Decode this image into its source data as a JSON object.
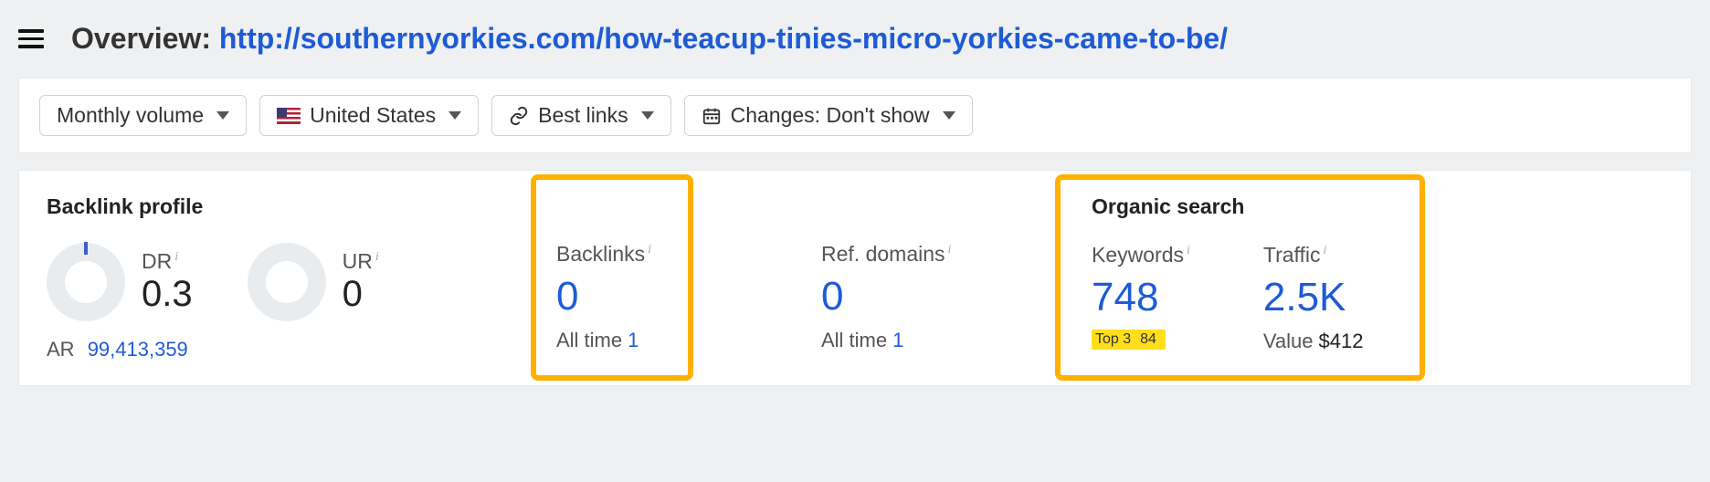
{
  "header": {
    "title_prefix": "Overview: ",
    "url": "http://southernyorkies.com/how-teacup-tinies-micro-yorkies-came-to-be/"
  },
  "toolbar": {
    "volume": "Monthly volume",
    "country": "United States",
    "best_links": "Best links",
    "changes": "Changes: Don't show"
  },
  "backlink_profile": {
    "title": "Backlink profile",
    "dr_label": "DR",
    "dr_value": "0.3",
    "ur_label": "UR",
    "ur_value": "0",
    "ar_label": "AR",
    "ar_value": "99,413,359",
    "backlinks_label": "Backlinks",
    "backlinks_value": "0",
    "backlinks_sub_label": "All time",
    "backlinks_sub_value": "1",
    "refdomains_label": "Ref. domains",
    "refdomains_value": "0",
    "refdomains_sub_label": "All time",
    "refdomains_sub_value": "1"
  },
  "organic": {
    "title": "Organic search",
    "keywords_label": "Keywords",
    "keywords_value": "748",
    "keywords_sub_label": "Top 3",
    "keywords_sub_value": "84",
    "traffic_label": "Traffic",
    "traffic_value": "2.5K",
    "traffic_sub_label": "Value",
    "traffic_sub_value": "$412"
  }
}
